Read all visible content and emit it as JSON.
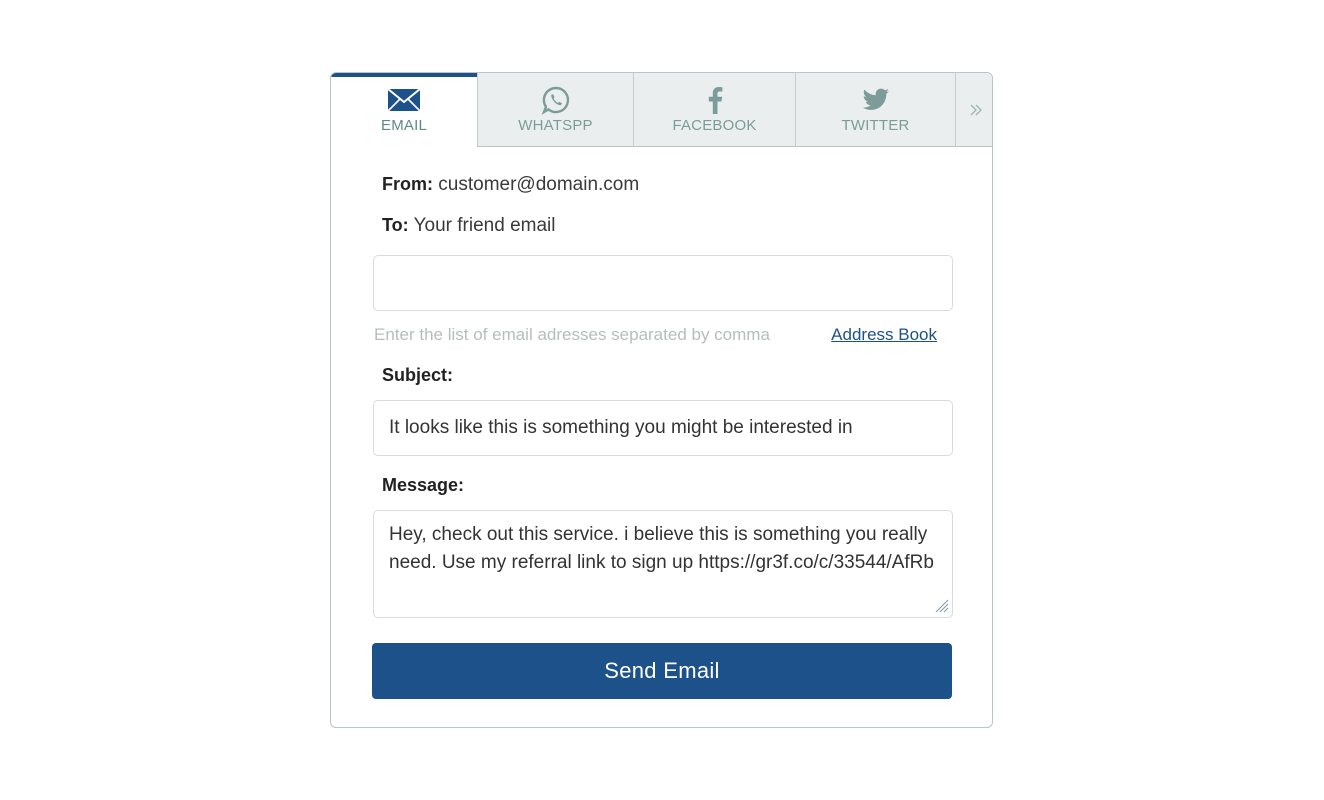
{
  "tabs": [
    {
      "label": "EMAIL",
      "icon": "envelope-icon",
      "active": true
    },
    {
      "label": "WHATSPP",
      "icon": "whatsapp-icon",
      "active": false
    },
    {
      "label": "FACEBOOK",
      "icon": "facebook-icon",
      "active": false
    },
    {
      "label": "TWITTER",
      "icon": "twitter-icon",
      "active": false
    }
  ],
  "more_icon": "double-chevron-right-icon",
  "form": {
    "from_label": "From:",
    "from_value": "customer@domain.com",
    "to_label": "To:",
    "to_value": "Your friend email",
    "to_input_value": "",
    "to_hint": "Enter the list of email adresses separated by comma",
    "address_book_link": "Address Book",
    "subject_label": "Subject:",
    "subject_value": "It looks like this is something you might be interested in",
    "message_label": "Message:",
    "message_value": "Hey, check out this service. i believe this is something you really need. Use my referral link to sign up https://gr3f.co/c/33544/AfRb",
    "send_button": "Send Email"
  },
  "colors": {
    "accent": "#1c5189",
    "tab_label": "#7b9c98",
    "tab_background": "#ebeeef",
    "hint_text": "#b7bdbd"
  }
}
